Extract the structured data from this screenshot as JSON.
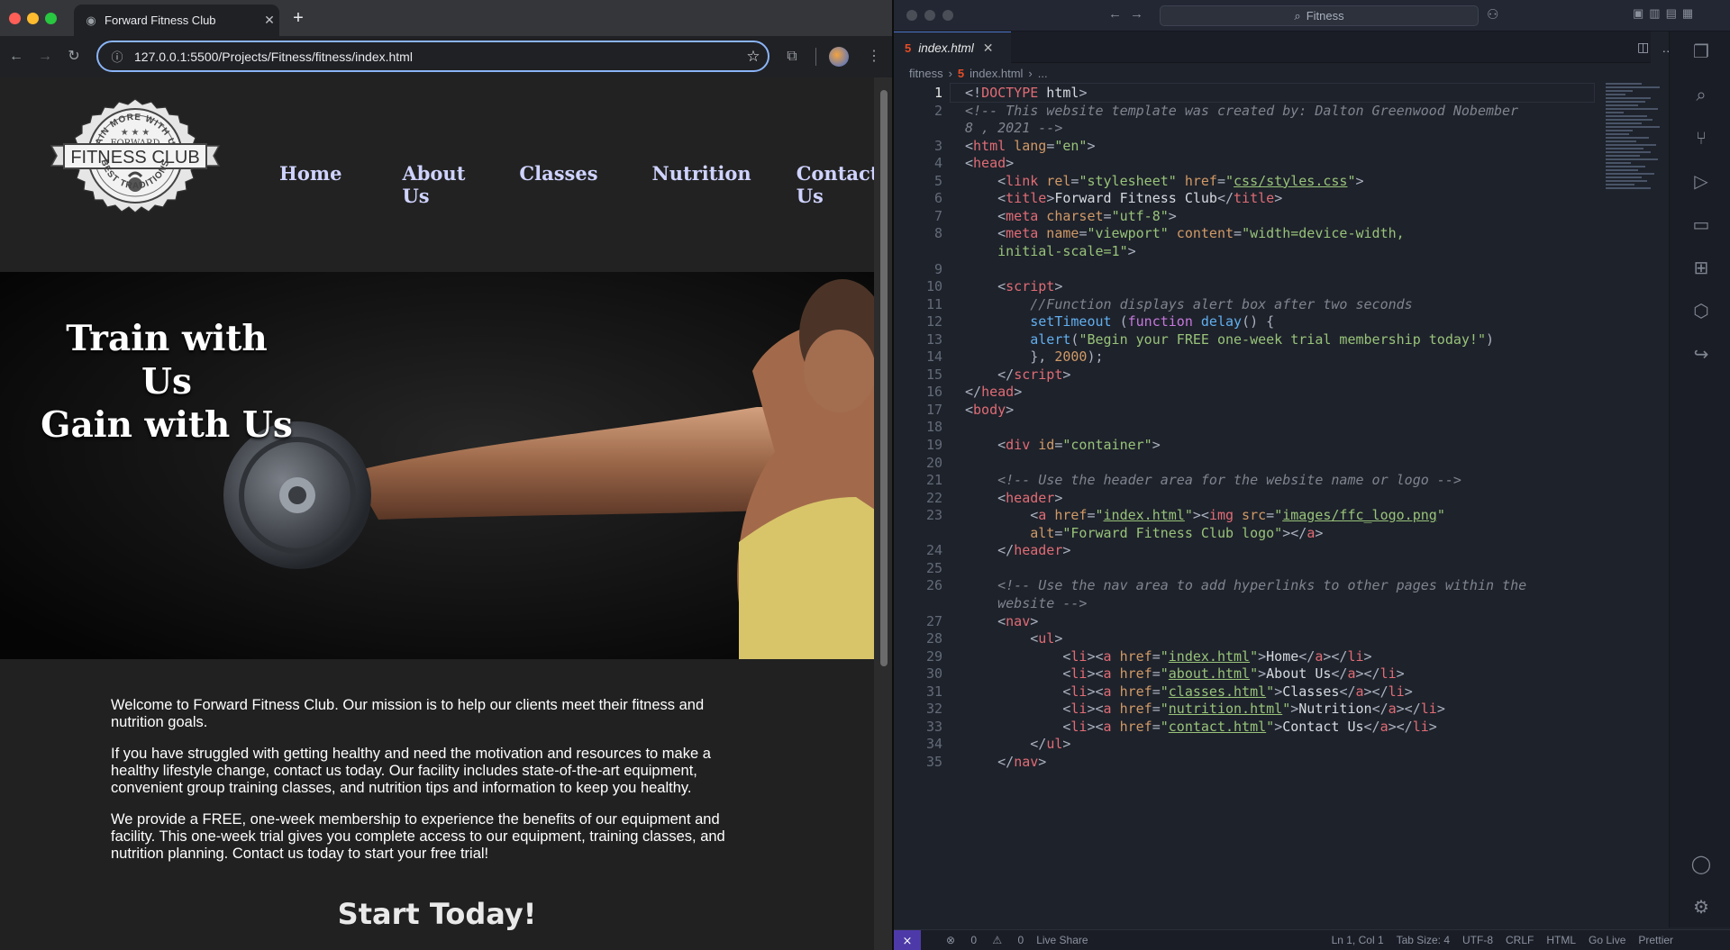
{
  "browser": {
    "tab_title": "Forward Fitness Club",
    "url": "127.0.0.1:5500/Projects/Fitness/fitness/index.html",
    "icons": [
      "back-icon",
      "forward-icon",
      "reload-icon",
      "info-icon",
      "star-icon",
      "cast-icon",
      "profile-avatar",
      "menu-icon"
    ]
  },
  "site": {
    "logo": {
      "top": "GAIN MORE WITH US",
      "forward": "FORWARD",
      "main": "FITNESS CLUB",
      "bottom": "BEST TRADITIONS"
    },
    "nav": [
      "Home",
      "About Us",
      "Classes",
      "Nutrition",
      "Contact Us"
    ],
    "hero_line1": "Train with Us",
    "hero_line2": "Gain with Us",
    "paragraphs": [
      "Welcome to Forward Fitness Club. Our mission is to help our clients meet their fitness and nutrition goals.",
      "If you have struggled with getting healthy and need the motivation and resources to make a healthy lifestyle change, contact us today. Our facility includes state-of-the-art equipment, convenient group training classes, and nutrition tips and information to keep you healthy.",
      "We provide a FREE, one-week membership to experience the benefits of our equipment and facility. This one-week trial gives you complete access to our equipment, training classes, and nutrition planning. Contact us today to start your free trial!"
    ],
    "cta": "Start Today!"
  },
  "vscode": {
    "search": "Fitness",
    "tab": "index.html",
    "breadcrumb": [
      "fitness",
      "index.html",
      "..."
    ],
    "status": {
      "errors": "0",
      "warnings": "0",
      "live_share": "Live Share",
      "position": "Ln 1, Col 1",
      "tab_size": "Tab Size: 4",
      "encoding": "UTF-8",
      "eol": "CRLF",
      "language": "HTML",
      "go_live": "Go Live",
      "prettier": "Prettier"
    },
    "lines": [
      {
        "n": "1",
        "cur": true,
        "t": [
          [
            "pn",
            "<!"
          ],
          [
            "tg",
            "DOCTYPE"
          ],
          [
            "pl",
            " html"
          ],
          [
            "pn",
            ">"
          ]
        ]
      },
      {
        "n": "2",
        "t": [
          [
            "cm",
            "<!-- This website template was created by: Dalton Greenwood Nobember"
          ]
        ]
      },
      {
        "n": "",
        "t": [
          [
            "cm",
            "8 , 2021 -->"
          ]
        ]
      },
      {
        "n": "3",
        "t": [
          [
            "pn",
            "<"
          ],
          [
            "tg",
            "html"
          ],
          [
            "at",
            " lang"
          ],
          [
            "pn",
            "="
          ],
          [
            "st",
            "\"en\""
          ],
          [
            "pn",
            ">"
          ]
        ]
      },
      {
        "n": "4",
        "t": [
          [
            "pn",
            "<"
          ],
          [
            "tg",
            "head"
          ],
          [
            "pn",
            ">"
          ]
        ]
      },
      {
        "n": "5",
        "t": [
          [
            "pl",
            "    "
          ],
          [
            "pn",
            "<"
          ],
          [
            "tg",
            "link"
          ],
          [
            "at",
            " rel"
          ],
          [
            "pn",
            "="
          ],
          [
            "st",
            "\"stylesheet\""
          ],
          [
            "at",
            " href"
          ],
          [
            "pn",
            "="
          ],
          [
            "st",
            "\""
          ],
          [
            "stu",
            "css/styles.css"
          ],
          [
            "st",
            "\""
          ],
          [
            "pn",
            ">"
          ]
        ]
      },
      {
        "n": "6",
        "t": [
          [
            "pl",
            "    "
          ],
          [
            "pn",
            "<"
          ],
          [
            "tg",
            "title"
          ],
          [
            "pn",
            ">"
          ],
          [
            "pl",
            "Forward Fitness Club"
          ],
          [
            "pn",
            "</"
          ],
          [
            "tg",
            "title"
          ],
          [
            "pn",
            ">"
          ]
        ]
      },
      {
        "n": "7",
        "t": [
          [
            "pl",
            "    "
          ],
          [
            "pn",
            "<"
          ],
          [
            "tg",
            "meta"
          ],
          [
            "at",
            " charset"
          ],
          [
            "pn",
            "="
          ],
          [
            "st",
            "\"utf-8\""
          ],
          [
            "pn",
            ">"
          ]
        ]
      },
      {
        "n": "8",
        "t": [
          [
            "pl",
            "    "
          ],
          [
            "pn",
            "<"
          ],
          [
            "tg",
            "meta"
          ],
          [
            "at",
            " name"
          ],
          [
            "pn",
            "="
          ],
          [
            "st",
            "\"viewport\""
          ],
          [
            "at",
            " content"
          ],
          [
            "pn",
            "="
          ],
          [
            "st",
            "\"width=device-width,"
          ]
        ]
      },
      {
        "n": "",
        "t": [
          [
            "st",
            "    initial-scale=1\""
          ],
          [
            "pn",
            ">"
          ]
        ]
      },
      {
        "n": "9",
        "t": []
      },
      {
        "n": "10",
        "t": [
          [
            "pl",
            "    "
          ],
          [
            "pn",
            "<"
          ],
          [
            "tg",
            "script"
          ],
          [
            "pn",
            ">"
          ]
        ]
      },
      {
        "n": "11",
        "t": [
          [
            "pl",
            "        "
          ],
          [
            "cm",
            "//Function displays alert box after two seconds"
          ]
        ]
      },
      {
        "n": "12",
        "t": [
          [
            "pl",
            "        "
          ],
          [
            "fn",
            "setTimeout"
          ],
          [
            "pl",
            " "
          ],
          [
            "pn",
            "("
          ],
          [
            "kw",
            "function"
          ],
          [
            "pl",
            " "
          ],
          [
            "fn",
            "delay"
          ],
          [
            "pn",
            "() {"
          ]
        ]
      },
      {
        "n": "13",
        "t": [
          [
            "pl",
            "        "
          ],
          [
            "fn",
            "alert"
          ],
          [
            "pn",
            "("
          ],
          [
            "st",
            "\"Begin your FREE one-week trial membership today!\""
          ],
          [
            "pn",
            ")"
          ]
        ]
      },
      {
        "n": "14",
        "t": [
          [
            "pl",
            "        "
          ],
          [
            "pn",
            "}, "
          ],
          [
            "nu",
            "2000"
          ],
          [
            "pn",
            ");"
          ]
        ]
      },
      {
        "n": "15",
        "t": [
          [
            "pl",
            "    "
          ],
          [
            "pn",
            "</"
          ],
          [
            "tg",
            "script"
          ],
          [
            "pn",
            ">"
          ]
        ]
      },
      {
        "n": "16",
        "t": [
          [
            "pn",
            "</"
          ],
          [
            "tg",
            "head"
          ],
          [
            "pn",
            ">"
          ]
        ]
      },
      {
        "n": "17",
        "t": [
          [
            "pn",
            "<"
          ],
          [
            "tg",
            "body"
          ],
          [
            "pn",
            ">"
          ]
        ]
      },
      {
        "n": "18",
        "t": []
      },
      {
        "n": "19",
        "t": [
          [
            "pl",
            "    "
          ],
          [
            "pn",
            "<"
          ],
          [
            "tg",
            "div"
          ],
          [
            "at",
            " id"
          ],
          [
            "pn",
            "="
          ],
          [
            "st",
            "\"container\""
          ],
          [
            "pn",
            ">"
          ]
        ]
      },
      {
        "n": "20",
        "t": []
      },
      {
        "n": "21",
        "t": [
          [
            "pl",
            "    "
          ],
          [
            "cm",
            "<!-- Use the header area for the website name or logo -->"
          ]
        ]
      },
      {
        "n": "22",
        "t": [
          [
            "pl",
            "    "
          ],
          [
            "pn",
            "<"
          ],
          [
            "tg",
            "header"
          ],
          [
            "pn",
            ">"
          ]
        ]
      },
      {
        "n": "23",
        "t": [
          [
            "pl",
            "        "
          ],
          [
            "pn",
            "<"
          ],
          [
            "tg",
            "a"
          ],
          [
            "at",
            " href"
          ],
          [
            "pn",
            "="
          ],
          [
            "st",
            "\""
          ],
          [
            "stu",
            "index.html"
          ],
          [
            "st",
            "\""
          ],
          [
            "pn",
            "><"
          ],
          [
            "tg",
            "img"
          ],
          [
            "at",
            " src"
          ],
          [
            "pn",
            "="
          ],
          [
            "st",
            "\""
          ],
          [
            "stu",
            "images/ffc_logo.png"
          ],
          [
            "st",
            "\""
          ]
        ]
      },
      {
        "n": "",
        "t": [
          [
            "pl",
            "        "
          ],
          [
            "at",
            "alt"
          ],
          [
            "pn",
            "="
          ],
          [
            "st",
            "\"Forward Fitness Club logo\""
          ],
          [
            "pn",
            "></"
          ],
          [
            "tg",
            "a"
          ],
          [
            "pn",
            ">"
          ]
        ]
      },
      {
        "n": "24",
        "t": [
          [
            "pl",
            "    "
          ],
          [
            "pn",
            "</"
          ],
          [
            "tg",
            "header"
          ],
          [
            "pn",
            ">"
          ]
        ]
      },
      {
        "n": "25",
        "t": []
      },
      {
        "n": "26",
        "t": [
          [
            "pl",
            "    "
          ],
          [
            "cm",
            "<!-- Use the nav area to add hyperlinks to other pages within the"
          ]
        ]
      },
      {
        "n": "",
        "t": [
          [
            "cm",
            "    website -->"
          ]
        ]
      },
      {
        "n": "27",
        "t": [
          [
            "pl",
            "    "
          ],
          [
            "pn",
            "<"
          ],
          [
            "tg",
            "nav"
          ],
          [
            "pn",
            ">"
          ]
        ]
      },
      {
        "n": "28",
        "t": [
          [
            "pl",
            "        "
          ],
          [
            "pn",
            "<"
          ],
          [
            "tg",
            "ul"
          ],
          [
            "pn",
            ">"
          ]
        ]
      },
      {
        "n": "29",
        "t": [
          [
            "pl",
            "            "
          ],
          [
            "pn",
            "<"
          ],
          [
            "tg",
            "li"
          ],
          [
            "pn",
            "><"
          ],
          [
            "tg",
            "a"
          ],
          [
            "at",
            " href"
          ],
          [
            "pn",
            "="
          ],
          [
            "st",
            "\""
          ],
          [
            "stu",
            "index.html"
          ],
          [
            "st",
            "\""
          ],
          [
            "pn",
            ">"
          ],
          [
            "pl",
            "Home"
          ],
          [
            "pn",
            "</"
          ],
          [
            "tg",
            "a"
          ],
          [
            "pn",
            "></"
          ],
          [
            "tg",
            "li"
          ],
          [
            "pn",
            ">"
          ]
        ]
      },
      {
        "n": "30",
        "t": [
          [
            "pl",
            "            "
          ],
          [
            "pn",
            "<"
          ],
          [
            "tg",
            "li"
          ],
          [
            "pn",
            "><"
          ],
          [
            "tg",
            "a"
          ],
          [
            "at",
            " href"
          ],
          [
            "pn",
            "="
          ],
          [
            "st",
            "\""
          ],
          [
            "stu",
            "about.html"
          ],
          [
            "st",
            "\""
          ],
          [
            "pn",
            ">"
          ],
          [
            "pl",
            "About Us"
          ],
          [
            "pn",
            "</"
          ],
          [
            "tg",
            "a"
          ],
          [
            "pn",
            "></"
          ],
          [
            "tg",
            "li"
          ],
          [
            "pn",
            ">"
          ]
        ]
      },
      {
        "n": "31",
        "t": [
          [
            "pl",
            "            "
          ],
          [
            "pn",
            "<"
          ],
          [
            "tg",
            "li"
          ],
          [
            "pn",
            "><"
          ],
          [
            "tg",
            "a"
          ],
          [
            "at",
            " href"
          ],
          [
            "pn",
            "="
          ],
          [
            "st",
            "\""
          ],
          [
            "stu",
            "classes.html"
          ],
          [
            "st",
            "\""
          ],
          [
            "pn",
            ">"
          ],
          [
            "pl",
            "Classes"
          ],
          [
            "pn",
            "</"
          ],
          [
            "tg",
            "a"
          ],
          [
            "pn",
            "></"
          ],
          [
            "tg",
            "li"
          ],
          [
            "pn",
            ">"
          ]
        ]
      },
      {
        "n": "32",
        "t": [
          [
            "pl",
            "            "
          ],
          [
            "pn",
            "<"
          ],
          [
            "tg",
            "li"
          ],
          [
            "pn",
            "><"
          ],
          [
            "tg",
            "a"
          ],
          [
            "at",
            " href"
          ],
          [
            "pn",
            "="
          ],
          [
            "st",
            "\""
          ],
          [
            "stu",
            "nutrition.html"
          ],
          [
            "st",
            "\""
          ],
          [
            "pn",
            ">"
          ],
          [
            "pl",
            "Nutrition"
          ],
          [
            "pn",
            "</"
          ],
          [
            "tg",
            "a"
          ],
          [
            "pn",
            "></"
          ],
          [
            "tg",
            "li"
          ],
          [
            "pn",
            ">"
          ]
        ]
      },
      {
        "n": "33",
        "t": [
          [
            "pl",
            "            "
          ],
          [
            "pn",
            "<"
          ],
          [
            "tg",
            "li"
          ],
          [
            "pn",
            "><"
          ],
          [
            "tg",
            "a"
          ],
          [
            "at",
            " href"
          ],
          [
            "pn",
            "="
          ],
          [
            "st",
            "\""
          ],
          [
            "stu",
            "contact.html"
          ],
          [
            "st",
            "\""
          ],
          [
            "pn",
            ">"
          ],
          [
            "pl",
            "Contact Us"
          ],
          [
            "pn",
            "</"
          ],
          [
            "tg",
            "a"
          ],
          [
            "pn",
            "></"
          ],
          [
            "tg",
            "li"
          ],
          [
            "pn",
            ">"
          ]
        ]
      },
      {
        "n": "34",
        "t": [
          [
            "pl",
            "        "
          ],
          [
            "pn",
            "</"
          ],
          [
            "tg",
            "ul"
          ],
          [
            "pn",
            ">"
          ]
        ]
      },
      {
        "n": "35",
        "t": [
          [
            "pl",
            "    "
          ],
          [
            "pn",
            "</"
          ],
          [
            "tg",
            "nav"
          ],
          [
            "pn",
            ">"
          ]
        ]
      }
    ]
  }
}
